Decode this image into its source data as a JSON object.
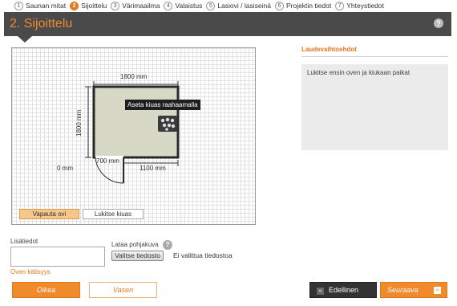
{
  "steps": [
    {
      "num": "1",
      "label": "Saunan mitat",
      "active": false
    },
    {
      "num": "2",
      "label": "Sijoittelu",
      "active": true
    },
    {
      "num": "3",
      "label": "Värimaailma",
      "active": false
    },
    {
      "num": "4",
      "label": "Valaistus",
      "active": false
    },
    {
      "num": "5",
      "label": "Lasiovi / lasiseinä",
      "active": false
    },
    {
      "num": "6",
      "label": "Projektin tiedot",
      "active": false
    },
    {
      "num": "7",
      "label": "Yhteystiedot",
      "active": false
    }
  ],
  "header": {
    "title": "2. Sijoittelu",
    "help": "?"
  },
  "plan": {
    "width_label": "1800 mm",
    "height_label": "1800 mm",
    "door_label": "700 mm",
    "wall_right_label": "1100 mm",
    "offset_label": "0 mm",
    "tooltip": "Aseta kiuas raahaamalla",
    "room_fill": "#d8d8c6",
    "release_door_label": "Vapauta ovi",
    "lock_heater_label": "Lukitse kiuas"
  },
  "side": {
    "title": "Laudevaihtoehdot",
    "message": "Lukitse ensin oven ja kiukaan paikat"
  },
  "form": {
    "notes_label": "Lisätiedot",
    "hinge_link": "Oven kätisyys",
    "upload_label": "Lataa pohjakuva",
    "upload_help": "?",
    "file_button": "Valitse tiedosto",
    "file_status": "Ei valittua tiedostoa"
  },
  "buttons": {
    "right": "Oikea",
    "left": "Vasen",
    "prev": "Edellinen",
    "next": "Seuraava"
  },
  "colors": {
    "accent": "#f08a2a",
    "header_bg": "#4a4a4a"
  }
}
